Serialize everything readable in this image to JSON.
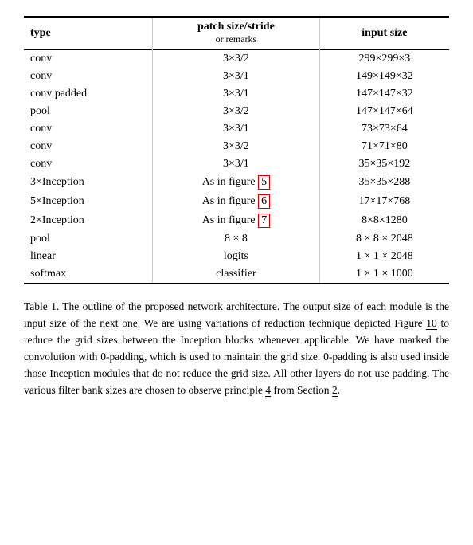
{
  "table": {
    "headers": [
      {
        "label": "type",
        "sub": ""
      },
      {
        "label": "patch size/stride",
        "sub": "or remarks"
      },
      {
        "label": "input size",
        "sub": ""
      }
    ],
    "rows": [
      {
        "type": "conv",
        "patch": "3×3/2",
        "input": "299×299×3"
      },
      {
        "type": "conv",
        "patch": "3×3/1",
        "input": "149×149×32"
      },
      {
        "type": "conv padded",
        "patch": "3×3/1",
        "input": "147×147×32"
      },
      {
        "type": "pool",
        "patch": "3×3/2",
        "input": "147×147×64"
      },
      {
        "type": "conv",
        "patch": "3×3/1",
        "input": "73×73×64"
      },
      {
        "type": "conv",
        "patch": "3×3/2",
        "input": "71×71×80"
      },
      {
        "type": "conv",
        "patch": "3×3/1",
        "input": "35×35×192"
      },
      {
        "type": "3×Inception",
        "patch": "As in figure 5",
        "patch_link": "5",
        "input": "35×35×288"
      },
      {
        "type": "5×Inception",
        "patch": "As in figure 6",
        "patch_link": "6",
        "input": "17×17×768"
      },
      {
        "type": "2×Inception",
        "patch": "As in figure 7",
        "patch_link": "7",
        "input": "8×8×1280"
      },
      {
        "type": "pool",
        "patch": "8 × 8",
        "input": "8 × 8 × 2048"
      },
      {
        "type": "linear",
        "patch": "logits",
        "input": "1 × 1 × 2048"
      },
      {
        "type": "softmax",
        "patch": "classifier",
        "input": "1 × 1 × 1000"
      }
    ]
  },
  "caption": {
    "text": "Table 1. The outline of the proposed network architecture.  The output size of each module is the input size of the next one.  We are using variations of reduction technique depicted Figure ",
    "link1": "10",
    "text2": " to reduce the grid sizes between the Inception blocks whenever applicable.  We have marked the convolution with 0-padding, which is used to maintain the grid size.  0-padding is also used inside those Inception modules that do not reduce the grid size.  All other layers do not use padding.  The various filter bank sizes are chosen to observe principle ",
    "link2": "4",
    "text3": " from Section ",
    "link3": "2",
    "text4": "."
  },
  "highlighted_rows": [
    7,
    8,
    9
  ]
}
